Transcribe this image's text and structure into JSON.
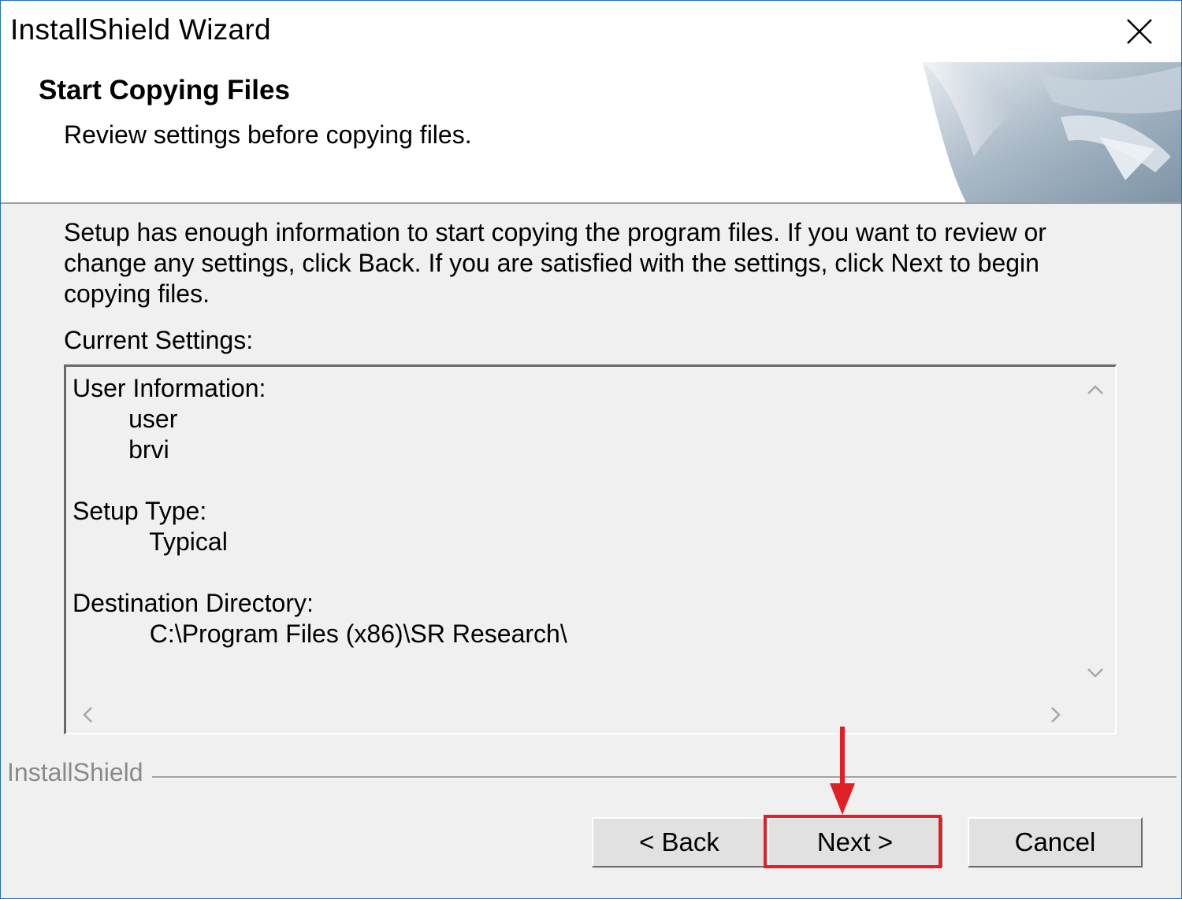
{
  "window": {
    "title": "InstallShield Wizard",
    "close_icon": "close-icon"
  },
  "banner": {
    "title": "Start Copying Files",
    "subtitle": "Review settings before copying files."
  },
  "main": {
    "description": "Setup has enough information to start copying the program files.  If you want to review or change any settings, click Back.  If you are satisfied with the settings, click Next to begin copying files.",
    "settings_label": "Current Settings:",
    "settings_lines": [
      "User Information:",
      "        user",
      "        brvi",
      "",
      "Setup Type:",
      "           Typical",
      "",
      "Destination Directory:",
      "           C:\\Program Files (x86)\\SR Research\\"
    ]
  },
  "footer": {
    "branding": "InstallShield",
    "back_label": "< Back",
    "next_label": "Next >",
    "cancel_label": "Cancel"
  },
  "annotation": {
    "highlight_color": "#e01f26",
    "target": "next-button"
  }
}
